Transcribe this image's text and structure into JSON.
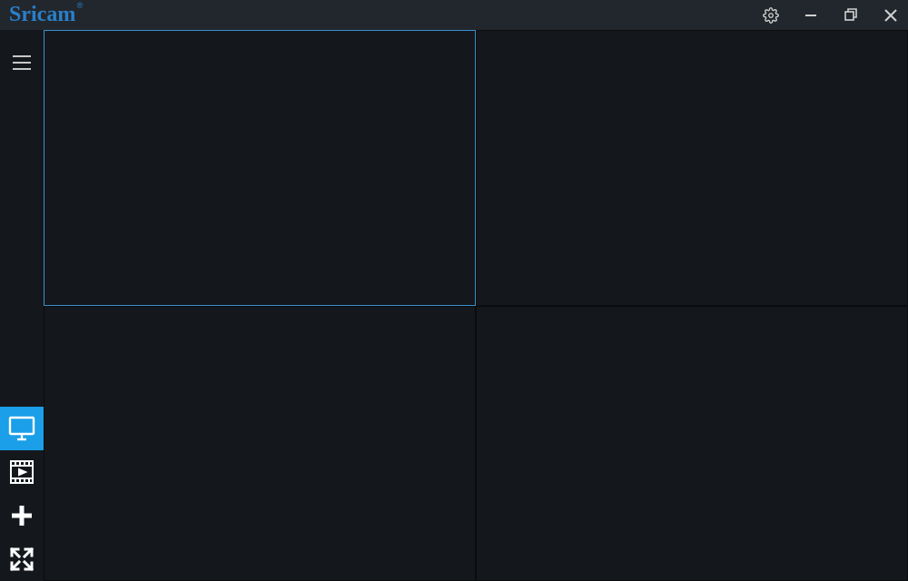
{
  "app": {
    "name": "Sricam",
    "trademark": "®"
  },
  "titlebar": {
    "controls": {
      "settings": "settings",
      "minimize": "minimize",
      "maximize": "maximize",
      "close": "close"
    }
  },
  "sidebar": {
    "top": {
      "menu": "hamburger"
    },
    "bottom": {
      "liveview": "liveview",
      "playback": "playback",
      "add": "add",
      "fullscreen": "fullscreen"
    },
    "active": "liveview"
  },
  "grid": {
    "layout": "2x2",
    "cells": [
      {
        "id": 0,
        "selected": true
      },
      {
        "id": 1,
        "selected": false
      },
      {
        "id": 2,
        "selected": false
      },
      {
        "id": 3,
        "selected": false
      }
    ]
  },
  "colors": {
    "accent": "#1a9fe8",
    "logo": "#2a7fc9",
    "bg": "#14181c",
    "titlebar": "#22272d"
  }
}
